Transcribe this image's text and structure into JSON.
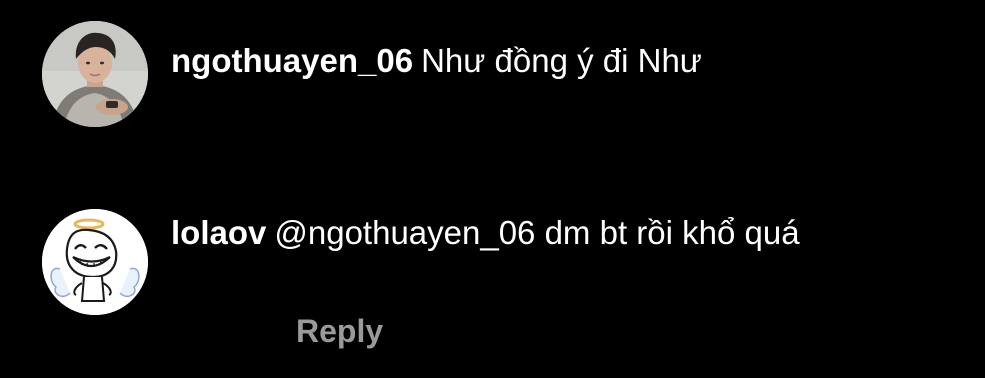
{
  "comments": [
    {
      "username": "ngothuayen_06",
      "text": "Như đồng ý đi Như"
    },
    {
      "username": "lolaov",
      "text": "@ngothuayen_06 dm bt rồi khổ quá",
      "reply_label": "Reply"
    }
  ],
  "colors": {
    "background": "#000000",
    "text": "#ffffff",
    "reply": "#9a9a9a"
  },
  "icons": [
    "user-photo-avatar",
    "meme-face-avatar"
  ]
}
